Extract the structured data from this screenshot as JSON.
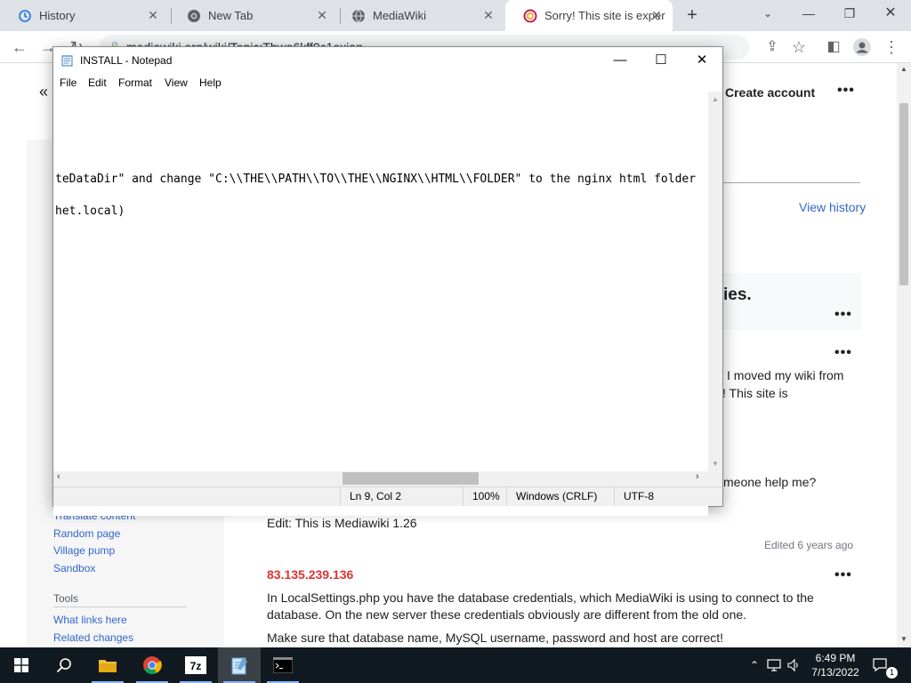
{
  "browser": {
    "tabs": [
      {
        "label": "History",
        "icon": "history-icon"
      },
      {
        "label": "New Tab",
        "icon": "chrome-icon"
      },
      {
        "label": "MediaWiki",
        "icon": "globe-icon"
      },
      {
        "label": "Sorry! This site is exper",
        "icon": "wiki-error-icon",
        "active": true
      }
    ],
    "address": "mediawiki.org/wiki/Topic:Thwa6kff0c1oxian"
  },
  "wiki": {
    "create_account": "Create account",
    "view_history": "View history",
    "topic_title_fragment": "ies.",
    "post_line1": "I moved my wiki from",
    "post_line2": "! This site is",
    "post_line3": "meone help me?",
    "edit_note": "Edit: This is Mediawiki 1.26",
    "edited_ago": "Edited 6 years ago",
    "reply_user": "83.135.239.136",
    "reply_line1": "In LocalSettings.php you have the database credentials, which MediaWiki is using to connect to the",
    "reply_line2": "database. On the new server these credentials obviously are different from the old one.",
    "reply_line3": "Make sure that database name, MySQL username, password and host are correct!",
    "sidebar": {
      "links_top": [
        "Translate content",
        "Random page",
        "Village pump",
        "Sandbox"
      ],
      "tools_heading": "Tools",
      "tools_links": [
        "What links here",
        "Related changes"
      ]
    }
  },
  "notepad": {
    "title": "INSTALL - Notepad",
    "menu": [
      "File",
      "Edit",
      "Format",
      "View",
      "Help"
    ],
    "lines": [
      "teDataDir\" and change \"C:\\\\THE\\\\PATH\\\\TO\\\\THE\\\\NGINX\\\\HTML\\\\FOLDER\" to the nginx html folder",
      "het.local)"
    ],
    "status": {
      "position": "Ln 9, Col 2",
      "zoom": "100%",
      "line_ending": "Windows (CRLF)",
      "encoding": "UTF-8"
    }
  },
  "taskbar": {
    "clock_time": "6:49 PM",
    "clock_date": "7/13/2022",
    "notification_count": "1",
    "apps": [
      "start-icon",
      "search-icon",
      "file-explorer-icon",
      "chrome-icon",
      "7zip-icon",
      "notepad-icon",
      "terminal-icon"
    ]
  }
}
